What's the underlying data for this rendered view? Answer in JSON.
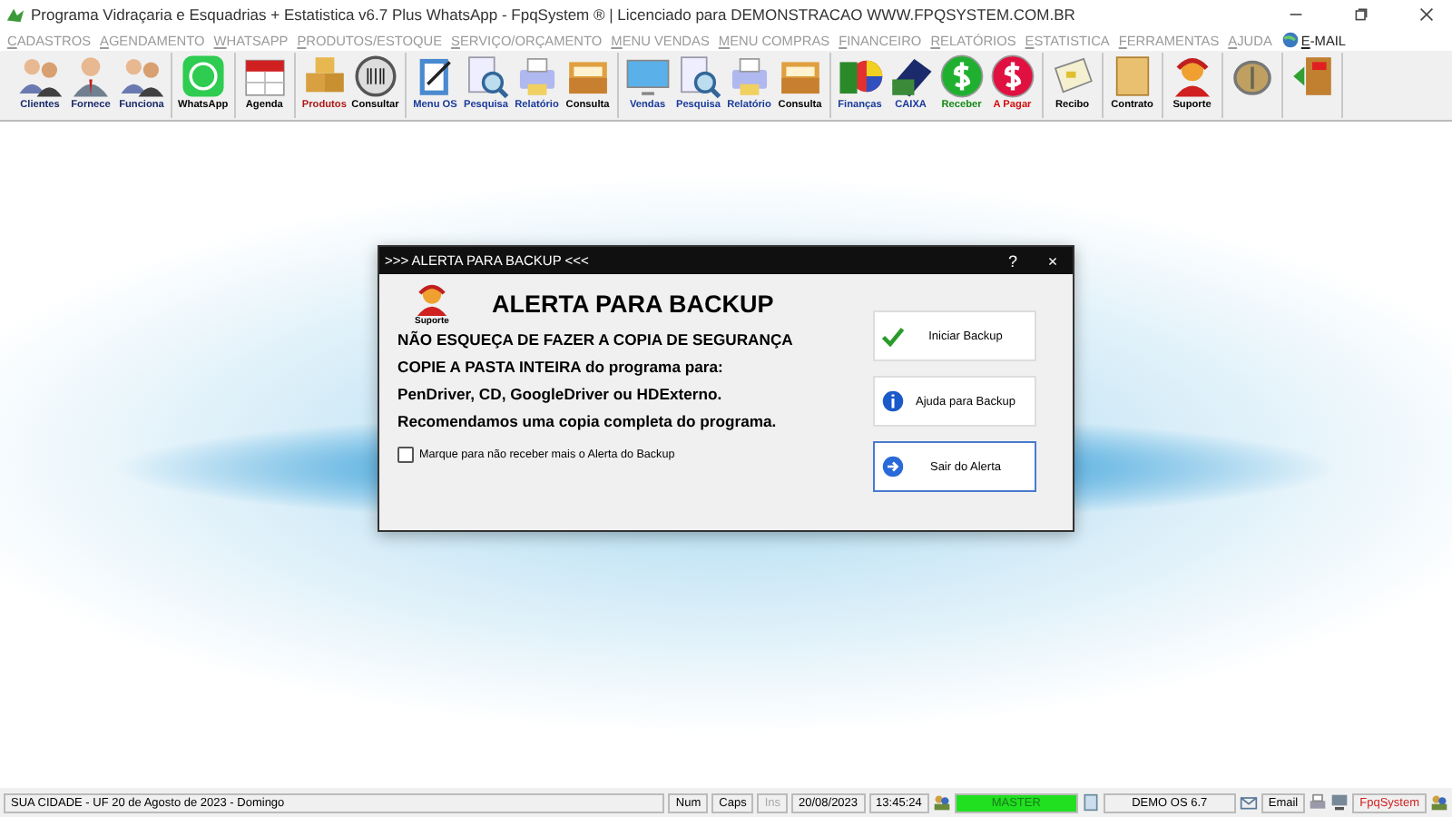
{
  "window": {
    "title": "Programa Vidraçaria e Esquadrias + Estatistica v6.7 Plus WhatsApp - FpqSystem ® | Licenciado para  DEMONSTRACAO WWW.FPQSYSTEM.COM.BR"
  },
  "menu": [
    {
      "label": "CADASTROS",
      "disabled": true
    },
    {
      "label": "AGENDAMENTO",
      "disabled": true
    },
    {
      "label": "WHATSAPP",
      "disabled": true
    },
    {
      "label": "PRODUTOS/ESTOQUE",
      "disabled": true
    },
    {
      "label": "SERVIÇO/ORÇAMENTO",
      "disabled": true
    },
    {
      "label": "MENU VENDAS",
      "disabled": true
    },
    {
      "label": "MENU COMPRAS",
      "disabled": true
    },
    {
      "label": "FINANCEIRO",
      "disabled": true
    },
    {
      "label": "RELATÓRIOS",
      "disabled": true
    },
    {
      "label": "ESTATISTICA",
      "disabled": true
    },
    {
      "label": "FERRAMENTAS",
      "disabled": true
    },
    {
      "label": "AJUDA",
      "disabled": true
    },
    {
      "label": "E-MAIL",
      "disabled": false
    }
  ],
  "toolbar": [
    [
      {
        "kind": "people",
        "label": "Clientes",
        "color": "#1a2a6a"
      },
      {
        "kind": "person",
        "label": "Fornece",
        "color": "#1a2a6a"
      },
      {
        "kind": "people",
        "label": "Funciona",
        "color": "#1a2a6a"
      }
    ],
    [
      {
        "kind": "whatsapp",
        "label": "WhatsApp",
        "color": "#000000"
      }
    ],
    [
      {
        "kind": "calendar",
        "label": "Agenda",
        "color": "#000000"
      }
    ],
    [
      {
        "kind": "boxes",
        "label": "Produtos",
        "color": "#b01818"
      },
      {
        "kind": "barcode",
        "label": "Consultar",
        "color": "#000000"
      }
    ],
    [
      {
        "kind": "clipboard",
        "label": "Menu OS",
        "color": "#1a3a9a"
      },
      {
        "kind": "search",
        "label": "Pesquisa",
        "color": "#1a3a9a"
      },
      {
        "kind": "printer",
        "label": "Relatório",
        "color": "#1a3a9a"
      },
      {
        "kind": "drawer",
        "label": "Consulta",
        "color": "#000000"
      }
    ],
    [
      {
        "kind": "monitor",
        "label": "Vendas",
        "color": "#1a3a9a"
      },
      {
        "kind": "search",
        "label": "Pesquisa",
        "color": "#1a3a9a"
      },
      {
        "kind": "printer",
        "label": "Relatório",
        "color": "#1a3a9a"
      },
      {
        "kind": "drawer",
        "label": "Consulta",
        "color": "#000000"
      }
    ],
    [
      {
        "kind": "chart",
        "label": "Finanças",
        "color": "#1a3a9a"
      },
      {
        "kind": "book",
        "label": "CAIXA",
        "color": "#1a3a9a"
      },
      {
        "kind": "dollar-receive",
        "label": "Receber",
        "color": "#138a13"
      },
      {
        "kind": "dollar-pay",
        "label": "A Pagar",
        "color": "#d01010"
      }
    ],
    [
      {
        "kind": "receipt",
        "label": "Recibo",
        "color": "#000000"
      }
    ],
    [
      {
        "kind": "paper",
        "label": "Contrato",
        "color": "#000000"
      }
    ],
    [
      {
        "kind": "support",
        "label": "Suporte",
        "color": "#000000"
      }
    ],
    [
      {
        "kind": "coin"
      }
    ],
    [
      {
        "kind": "exit"
      }
    ]
  ],
  "dialog": {
    "title": ">>> ALERTA PARA BACKUP <<<",
    "help": "?",
    "close": "×",
    "icon_caption": "Suporte",
    "heading": "ALERTA PARA BACKUP",
    "lines": [
      "NÃO ESQUEÇA DE FAZER A COPIA DE SEGURANÇA",
      "COPIE A PASTA INTEIRA do programa para:",
      "PenDriver, CD, GoogleDriver ou HDExterno.",
      "Recomendamos uma copia completa do programa."
    ],
    "checkbox": {
      "label": "Marque para não receber mais o Alerta do Backup",
      "checked": false
    },
    "buttons": [
      {
        "kind": "check",
        "label": "Iniciar Backup",
        "focused": false
      },
      {
        "kind": "info",
        "label": "Ajuda para Backup",
        "focused": false
      },
      {
        "kind": "arrow",
        "label": "Sair do Alerta",
        "focused": true
      }
    ]
  },
  "status_bar": {
    "location": "SUA CIDADE - UF 20 de Agosto de 2023 - Domingo",
    "keys": [
      {
        "label": "Num",
        "disabled": false
      },
      {
        "label": "Caps",
        "disabled": false
      },
      {
        "label": "Ins",
        "disabled": true
      }
    ],
    "date": "20/08/2023",
    "time": "13:45:24",
    "user": "MASTER",
    "version": "DEMO OS 6.7",
    "email": "Email",
    "brand": "FpqSystem"
  }
}
